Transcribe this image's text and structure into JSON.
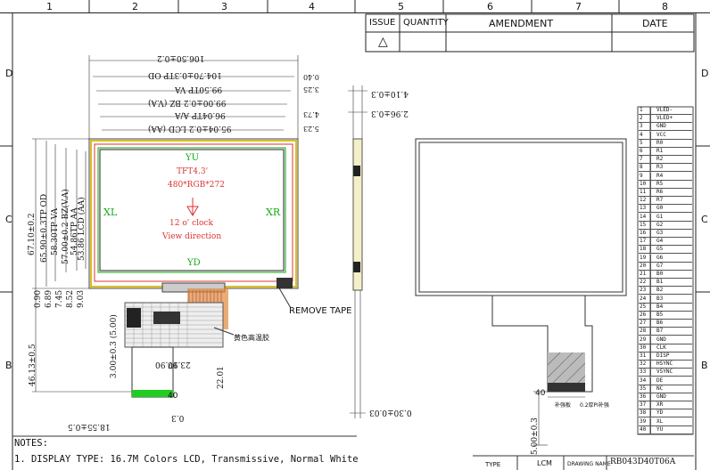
{
  "grid": {
    "columns": [
      "1",
      "2",
      "3",
      "4",
      "5",
      "6",
      "7",
      "8"
    ],
    "rows_left": [
      "D",
      "C",
      "B"
    ],
    "rows_right": [
      "D",
      "C",
      "B"
    ]
  },
  "revision_table": {
    "headers": {
      "issue": "ISSUE",
      "quantity": "QUANTITY",
      "amendment": "AMENDMENT",
      "date": "DATE"
    },
    "row1_symbol": "△"
  },
  "front_view": {
    "dims_top": [
      "106.50±0.2",
      "104.70±0.3TP OD",
      "99.50TP VA",
      "99.00±0.2 BZ (V.A)",
      "96.04TP A/A",
      "95.04±0.2 LCD (AA)"
    ],
    "dims_right_top": [
      "0.40",
      "3.25",
      "4.73",
      "5.23"
    ],
    "dims_left": [
      "67.10±0.2",
      "65.90±0.3TP OD",
      "58.30TP VA",
      "57.00±0.2 BZ(V.A)",
      "54.86TP AA",
      "53.86 LCD (AA)"
    ],
    "dims_left_small": [
      "0.90",
      "6.89",
      "7.45",
      "8.52",
      "9.03"
    ],
    "center_text": [
      "TFT4.3'",
      "480*RGB*272",
      "12 o' clock",
      "View direction"
    ],
    "labels": {
      "top": "YU",
      "bottom": "YD",
      "left": "XL",
      "right": "XR"
    },
    "remove_tape": "REMOVE TAPE",
    "chinese_label": "黄色高温胶",
    "fpc_dims": {
      "d1": "3.00±0.3 (5.00)",
      "d2": "22.01",
      "d3": "23.90",
      "d4": "17.90",
      "d5": "40",
      "d6": "0.3",
      "d7": "18.55±0.5",
      "d8": "46.13±0.5"
    }
  },
  "side_view": {
    "dims": [
      "4.10±0.3",
      "2.96±0.3",
      "0.30±0.03"
    ]
  },
  "back_view": {
    "dims": [
      "5.00±0.3",
      "40"
    ],
    "fpc_labels": [
      "补强板",
      "0.2厚PI补强"
    ]
  },
  "pinout": [
    {
      "n": "1",
      "s": "VLED-"
    },
    {
      "n": "2",
      "s": "VLED+"
    },
    {
      "n": "3",
      "s": "GND"
    },
    {
      "n": "4",
      "s": "VCC"
    },
    {
      "n": "5",
      "s": "R0"
    },
    {
      "n": "6",
      "s": "R1"
    },
    {
      "n": "7",
      "s": "R2"
    },
    {
      "n": "8",
      "s": "R3"
    },
    {
      "n": "9",
      "s": "R4"
    },
    {
      "n": "10",
      "s": "R5"
    },
    {
      "n": "11",
      "s": "R6"
    },
    {
      "n": "12",
      "s": "R7"
    },
    {
      "n": "13",
      "s": "G0"
    },
    {
      "n": "14",
      "s": "G1"
    },
    {
      "n": "15",
      "s": "G2"
    },
    {
      "n": "16",
      "s": "G3"
    },
    {
      "n": "17",
      "s": "G4"
    },
    {
      "n": "18",
      "s": "G5"
    },
    {
      "n": "19",
      "s": "G6"
    },
    {
      "n": "20",
      "s": "G7"
    },
    {
      "n": "21",
      "s": "B0"
    },
    {
      "n": "22",
      "s": "B1"
    },
    {
      "n": "23",
      "s": "B2"
    },
    {
      "n": "24",
      "s": "B3"
    },
    {
      "n": "25",
      "s": "B4"
    },
    {
      "n": "26",
      "s": "B5"
    },
    {
      "n": "27",
      "s": "B6"
    },
    {
      "n": "28",
      "s": "B7"
    },
    {
      "n": "29",
      "s": "GND"
    },
    {
      "n": "30",
      "s": "CLK"
    },
    {
      "n": "31",
      "s": "DISP"
    },
    {
      "n": "32",
      "s": "HSYNC"
    },
    {
      "n": "33",
      "s": "VSYNC"
    },
    {
      "n": "34",
      "s": "DE"
    },
    {
      "n": "35",
      "s": "NC"
    },
    {
      "n": "36",
      "s": "GND"
    },
    {
      "n": "37",
      "s": "XR"
    },
    {
      "n": "38",
      "s": "YD"
    },
    {
      "n": "39",
      "s": "XL"
    },
    {
      "n": "40",
      "s": "YU"
    }
  ],
  "notes": {
    "title": "NOTES:",
    "line1": "1. DISPLAY TYPE: 16.7M  Colors LCD, Transmissive, Normal White"
  },
  "title_block": {
    "type_label": "TYPE",
    "type_value": "LCM",
    "drawing_label": "DRAWING NAME",
    "drawing_value": "RB043D40T06A"
  },
  "colors": {
    "yellow": "#d8c020",
    "red": "#d33",
    "green": "#1a1",
    "orange": "#e07a2a"
  }
}
